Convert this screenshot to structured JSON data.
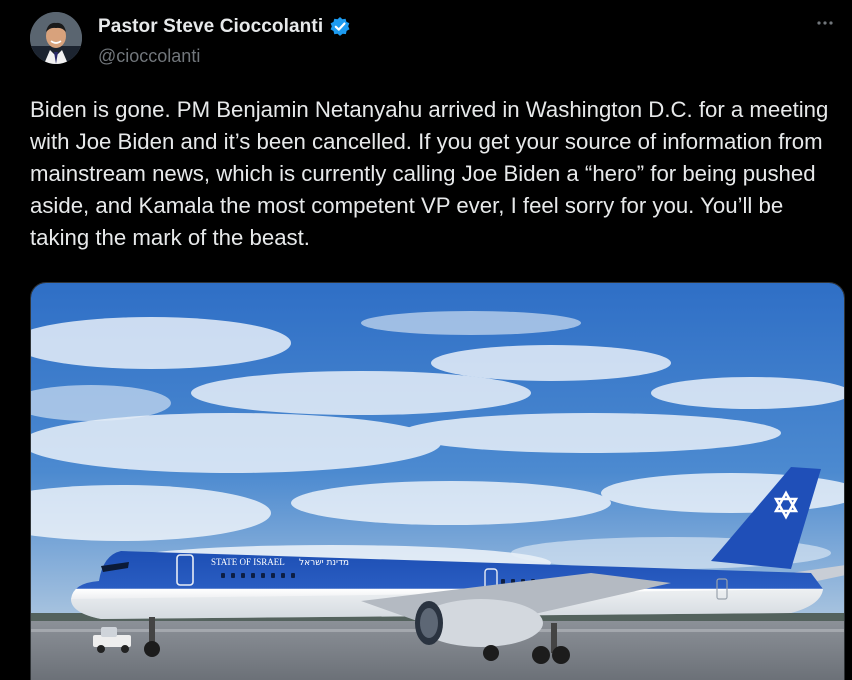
{
  "author": {
    "display_name": "Pastor Steve Cioccolanti",
    "handle": "@cioccolanti",
    "verified": true
  },
  "tweet": {
    "text": "Biden is gone. PM Benjamin Netanyahu arrived in Washington D.C. for a meeting with Joe Biden and it’s been cancelled. If you get your source of information from mainstream news, which is currently calling Joe Biden a “hero” for being pushed aside, and Kamala the most competent VP ever, I feel sorry for you. You’ll be taking the mark of the beast."
  },
  "media": {
    "fuselage_text": "STATE OF ISRAEL",
    "fuselage_text_hebrew": "מדינת ישראל"
  },
  "icons": {
    "verified": "verified-badge-icon",
    "more": "more-icon"
  },
  "colors": {
    "background": "#000000",
    "text": "#e7e9ea",
    "secondary": "#71767b",
    "verified_blue": "#1d9bf0",
    "plane_blue": "#1f4fb8"
  }
}
